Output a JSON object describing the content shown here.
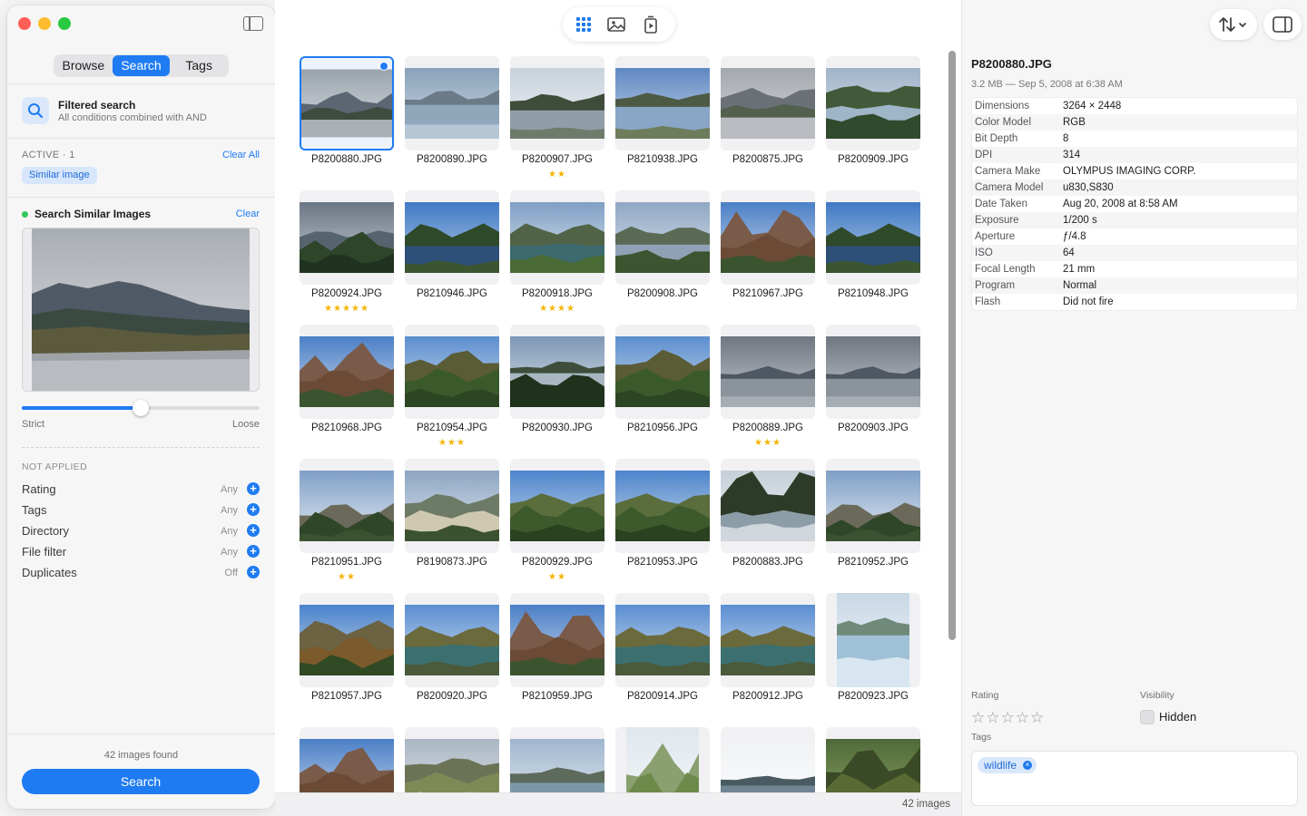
{
  "sidebar": {
    "tabs": [
      {
        "label": "Browse",
        "active": false
      },
      {
        "label": "Search",
        "active": true
      },
      {
        "label": "Tags",
        "active": false
      }
    ],
    "filtered": {
      "title": "Filtered search",
      "subtitle": "All conditions combined with AND"
    },
    "active_label": "ACTIVE · 1",
    "clear_all": "Clear All",
    "active_chip": "Similar image",
    "similar": {
      "title": "Search Similar Images",
      "clear": "Clear",
      "threshold": 0.5,
      "strict": "Strict",
      "loose": "Loose"
    },
    "not_applied_label": "NOT APPLIED",
    "filters": [
      {
        "name": "Rating",
        "value": "Any"
      },
      {
        "name": "Tags",
        "value": "Any"
      },
      {
        "name": "Directory",
        "value": "Any"
      },
      {
        "name": "File filter",
        "value": "Any"
      },
      {
        "name": "Duplicates",
        "value": "Off"
      }
    ],
    "found": "42 images found",
    "search_button": "Search"
  },
  "main": {
    "status": "42 images",
    "photos": [
      {
        "name": "P8200880.JPG",
        "stars": 0,
        "selected": true,
        "scene": "mountain-lake"
      },
      {
        "name": "P8200890.JPG",
        "stars": 0,
        "scene": "calm-lake"
      },
      {
        "name": "P8200907.JPG",
        "stars": 2,
        "scene": "shore-lake"
      },
      {
        "name": "P8210938.JPG",
        "stars": 0,
        "scene": "reflection"
      },
      {
        "name": "P8200875.JPG",
        "stars": 0,
        "scene": "grey-river"
      },
      {
        "name": "P8200909.JPG",
        "stars": 0,
        "scene": "forest-river"
      },
      {
        "name": "P8200924.JPG",
        "stars": 5,
        "scene": "cloudy-forest"
      },
      {
        "name": "P8210946.JPG",
        "stars": 0,
        "scene": "blue-river"
      },
      {
        "name": "P8200918.JPG",
        "stars": 4,
        "scene": "green-river"
      },
      {
        "name": "P8200908.JPG",
        "stars": 0,
        "scene": "valley-river"
      },
      {
        "name": "P8210967.JPG",
        "stars": 0,
        "scene": "red-mountain"
      },
      {
        "name": "P8210948.JPG",
        "stars": 0,
        "scene": "blue-river"
      },
      {
        "name": "P8210968.JPG",
        "stars": 0,
        "scene": "red-mountain"
      },
      {
        "name": "P8210954.JPG",
        "stars": 3,
        "scene": "forest-hill"
      },
      {
        "name": "P8200930.JPG",
        "stars": 0,
        "scene": "dark-forest"
      },
      {
        "name": "P8210956.JPG",
        "stars": 0,
        "scene": "forest-hill"
      },
      {
        "name": "P8200889.JPG",
        "stars": 3,
        "scene": "grey-lake"
      },
      {
        "name": "P8200903.JPG",
        "stars": 0,
        "scene": "grey-lake"
      },
      {
        "name": "P8210951.JPG",
        "stars": 2,
        "scene": "spruce"
      },
      {
        "name": "P8190873.JPG",
        "stars": 0,
        "scene": "cliff-valley"
      },
      {
        "name": "P8200929.JPG",
        "stars": 2,
        "scene": "green-valley"
      },
      {
        "name": "P8210953.JPG",
        "stars": 0,
        "scene": "green-valley"
      },
      {
        "name": "P8200883.JPG",
        "stars": 0,
        "scene": "rapids"
      },
      {
        "name": "P8210952.JPG",
        "stars": 0,
        "scene": "spruce"
      },
      {
        "name": "P8210957.JPG",
        "stars": 0,
        "scene": "autumn-forest"
      },
      {
        "name": "P8200920.JPG",
        "stars": 0,
        "scene": "island-river"
      },
      {
        "name": "P8210959.JPG",
        "stars": 0,
        "scene": "red-mountain"
      },
      {
        "name": "P8200914.JPG",
        "stars": 0,
        "scene": "island-river"
      },
      {
        "name": "P8200912.JPG",
        "stars": 0,
        "scene": "island-river"
      },
      {
        "name": "P8200923.JPG",
        "stars": 0,
        "scene": "bright-water",
        "portrait": true
      },
      {
        "name": "",
        "stars": 0,
        "scene": "red-mountain"
      },
      {
        "name": "",
        "stars": 0,
        "scene": "marsh"
      },
      {
        "name": "",
        "stars": 0,
        "scene": "people-boat"
      },
      {
        "name": "",
        "stars": 0,
        "scene": "birches",
        "portrait": true
      },
      {
        "name": "",
        "stars": 0,
        "scene": "far-shore"
      },
      {
        "name": "",
        "stars": 0,
        "scene": "forest-trunks"
      }
    ]
  },
  "inspector": {
    "title": "P8200880.JPG",
    "subtitle": "3.2 MB — Sep 5, 2008 at 6:38 AM",
    "metadata": [
      {
        "k": "Dimensions",
        "v": "3264 × 2448"
      },
      {
        "k": "Color Model",
        "v": "RGB"
      },
      {
        "k": "Bit Depth",
        "v": "8"
      },
      {
        "k": "DPI",
        "v": "314"
      },
      {
        "k": "Camera Make",
        "v": "OLYMPUS IMAGING CORP."
      },
      {
        "k": "Camera Model",
        "v": "u830,S830"
      },
      {
        "k": "Date Taken",
        "v": "Aug 20, 2008 at 8:58 AM"
      },
      {
        "k": "Exposure",
        "v": "1/200 s"
      },
      {
        "k": "Aperture",
        "v": "ƒ/4.8"
      },
      {
        "k": "ISO",
        "v": "64"
      },
      {
        "k": "Focal Length",
        "v": "21 mm"
      },
      {
        "k": "Program",
        "v": "Normal"
      },
      {
        "k": "Flash",
        "v": "Did not fire"
      }
    ],
    "rating_label": "Rating",
    "rating": 0,
    "visibility_label": "Visibility",
    "visibility_value": "Hidden",
    "tags_label": "Tags",
    "tags": [
      "wildlife"
    ]
  },
  "colors": {
    "accent": "#1f7bf2",
    "star": "#f5b400",
    "green_dot": "#34c759"
  }
}
